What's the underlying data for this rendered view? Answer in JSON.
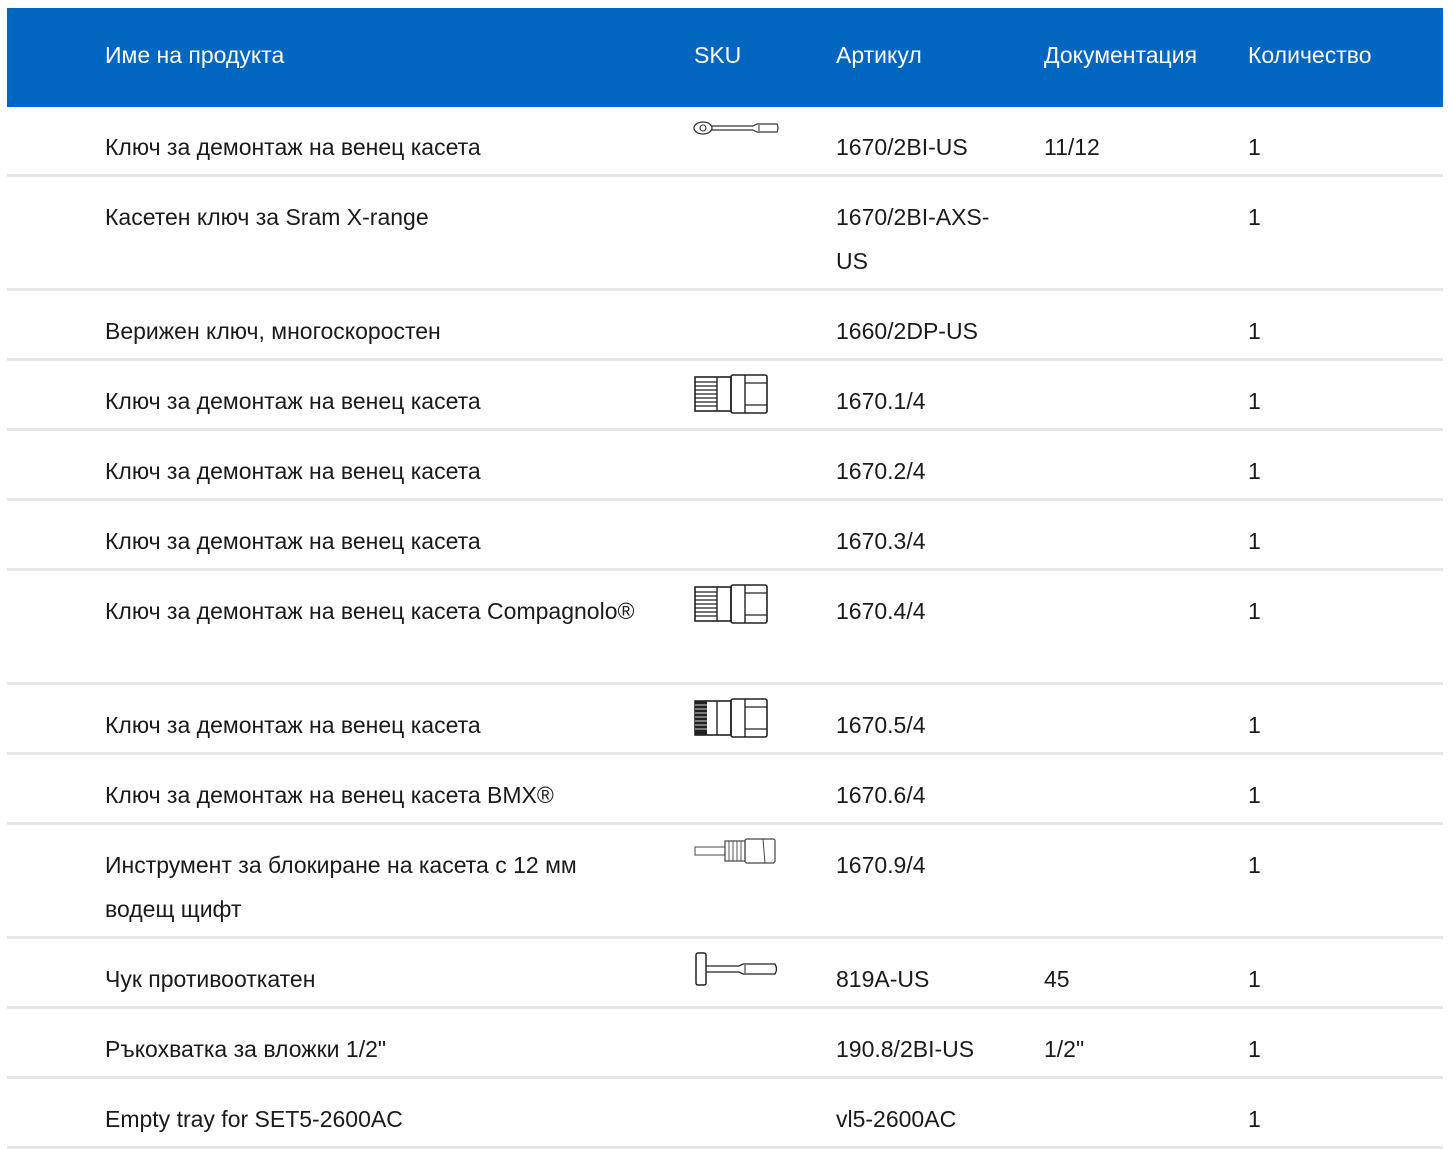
{
  "header": {
    "name": "Име на продукта",
    "sku": "SKU",
    "article": "Артикул",
    "docs": "Документация",
    "qty": "Количество"
  },
  "rows": [
    {
      "name": "Ключ за демонтаж на венец касета",
      "icon": "ratchet-wrench-icon",
      "article": "1670/2BI-US",
      "doc": "11/12",
      "qty": "1"
    },
    {
      "name": "Касетен ключ за Sram X-range",
      "icon": "",
      "article": "1670/2BI-AXS-US",
      "doc": "",
      "qty": "1"
    },
    {
      "name": "Верижен ключ, многоскоростен",
      "icon": "",
      "article": "1660/2DP-US",
      "doc": "",
      "qty": "1"
    },
    {
      "name": "Ключ за демонтаж на венец касета",
      "icon": "cassette-tool-icon",
      "article": "1670.1/4",
      "doc": "",
      "qty": "1"
    },
    {
      "name": "Ключ за демонтаж на венец касета",
      "icon": "",
      "article": "1670.2/4",
      "doc": "",
      "qty": "1"
    },
    {
      "name": "Ключ за демонтаж на венец касета",
      "icon": "",
      "article": "1670.3/4",
      "doc": "",
      "qty": "1"
    },
    {
      "name": "Ключ за демонтаж на венец касета Compagnolo®",
      "icon": "cassette-tool-icon",
      "article": "1670.4/4",
      "doc": "",
      "qty": "1"
    },
    {
      "name": "Ключ за демонтаж на венец касета",
      "icon": "cassette-tool-dense-icon",
      "article": "1670.5/4",
      "doc": "",
      "qty": "1"
    },
    {
      "name": "Ключ за демонтаж на венец касета BMX®",
      "icon": "",
      "article": "1670.6/4",
      "doc": "",
      "qty": "1"
    },
    {
      "name": "Инструмент за блокиране на касета с 12 мм водещ щифт",
      "icon": "lockring-pin-tool-icon",
      "article": "1670.9/4",
      "doc": "",
      "qty": "1"
    },
    {
      "name": "Чук противооткатен",
      "icon": "dead-blow-hammer-icon",
      "article": "819A-US",
      "doc": "45",
      "qty": "1"
    },
    {
      "name": "Ръкохватка за вложки 1/2\"",
      "icon": "",
      "article": "190.8/2BI-US",
      "doc": "1/2\"",
      "qty": "1"
    },
    {
      "name": "Empty tray for SET5-2600AC",
      "icon": "",
      "article": "vl5-2600AC",
      "doc": "",
      "qty": "1"
    }
  ]
}
